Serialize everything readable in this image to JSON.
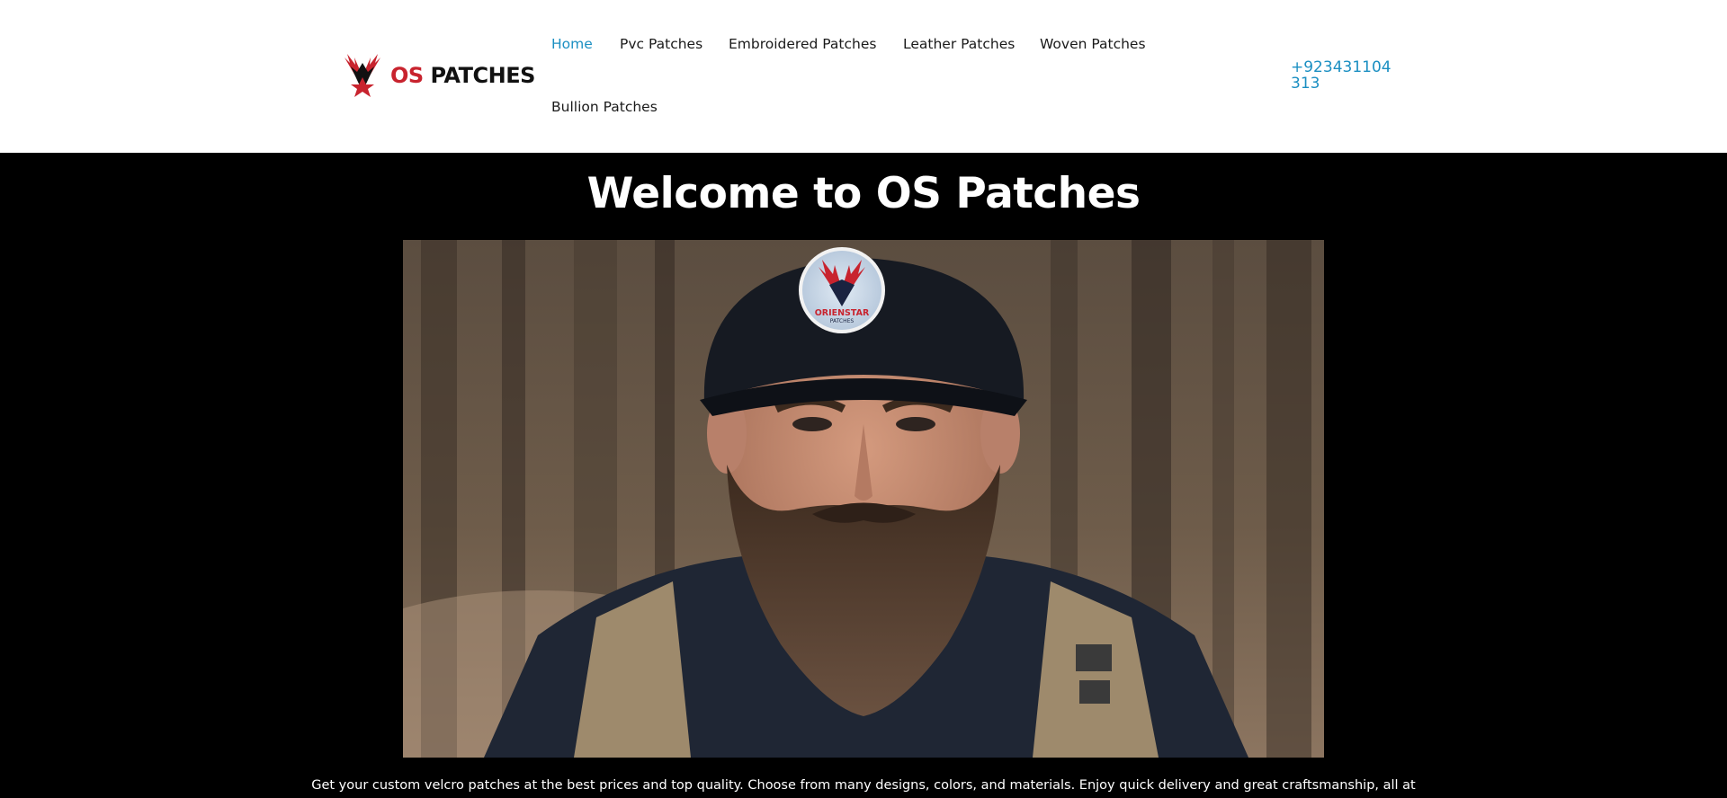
{
  "header": {
    "logo": {
      "text_os": "OS",
      "text_patches": "PATCHES",
      "colors": {
        "os": "#c8232e",
        "patches": "#111111"
      }
    },
    "nav": {
      "items": [
        {
          "label": "Home",
          "active": true
        },
        {
          "label": "Pvc Patches",
          "active": false
        },
        {
          "label": "Embroidered Patches",
          "active": false
        },
        {
          "label": "Leather Patches",
          "active": false
        },
        {
          "label": "Woven Patches",
          "active": false
        },
        {
          "label": "Bullion Patches",
          "active": false
        }
      ]
    },
    "phone": "+923431104313"
  },
  "hero": {
    "title": "Welcome to OS Patches",
    "image": {
      "icon": "bearded-man-cap-photo",
      "patch_text_line1": "ORIENSTAR",
      "patch_text_line2": "PATCHES"
    },
    "text": "Get your custom velcro patches at the best prices and top quality. Choose from many designs, colors, and materials. Enjoy quick delivery and great craftsmanship, all at"
  },
  "colors": {
    "accent": "#1b8fc2",
    "header_bg": "#ffffff",
    "hero_bg": "#000000",
    "brand_red": "#c8232e"
  }
}
